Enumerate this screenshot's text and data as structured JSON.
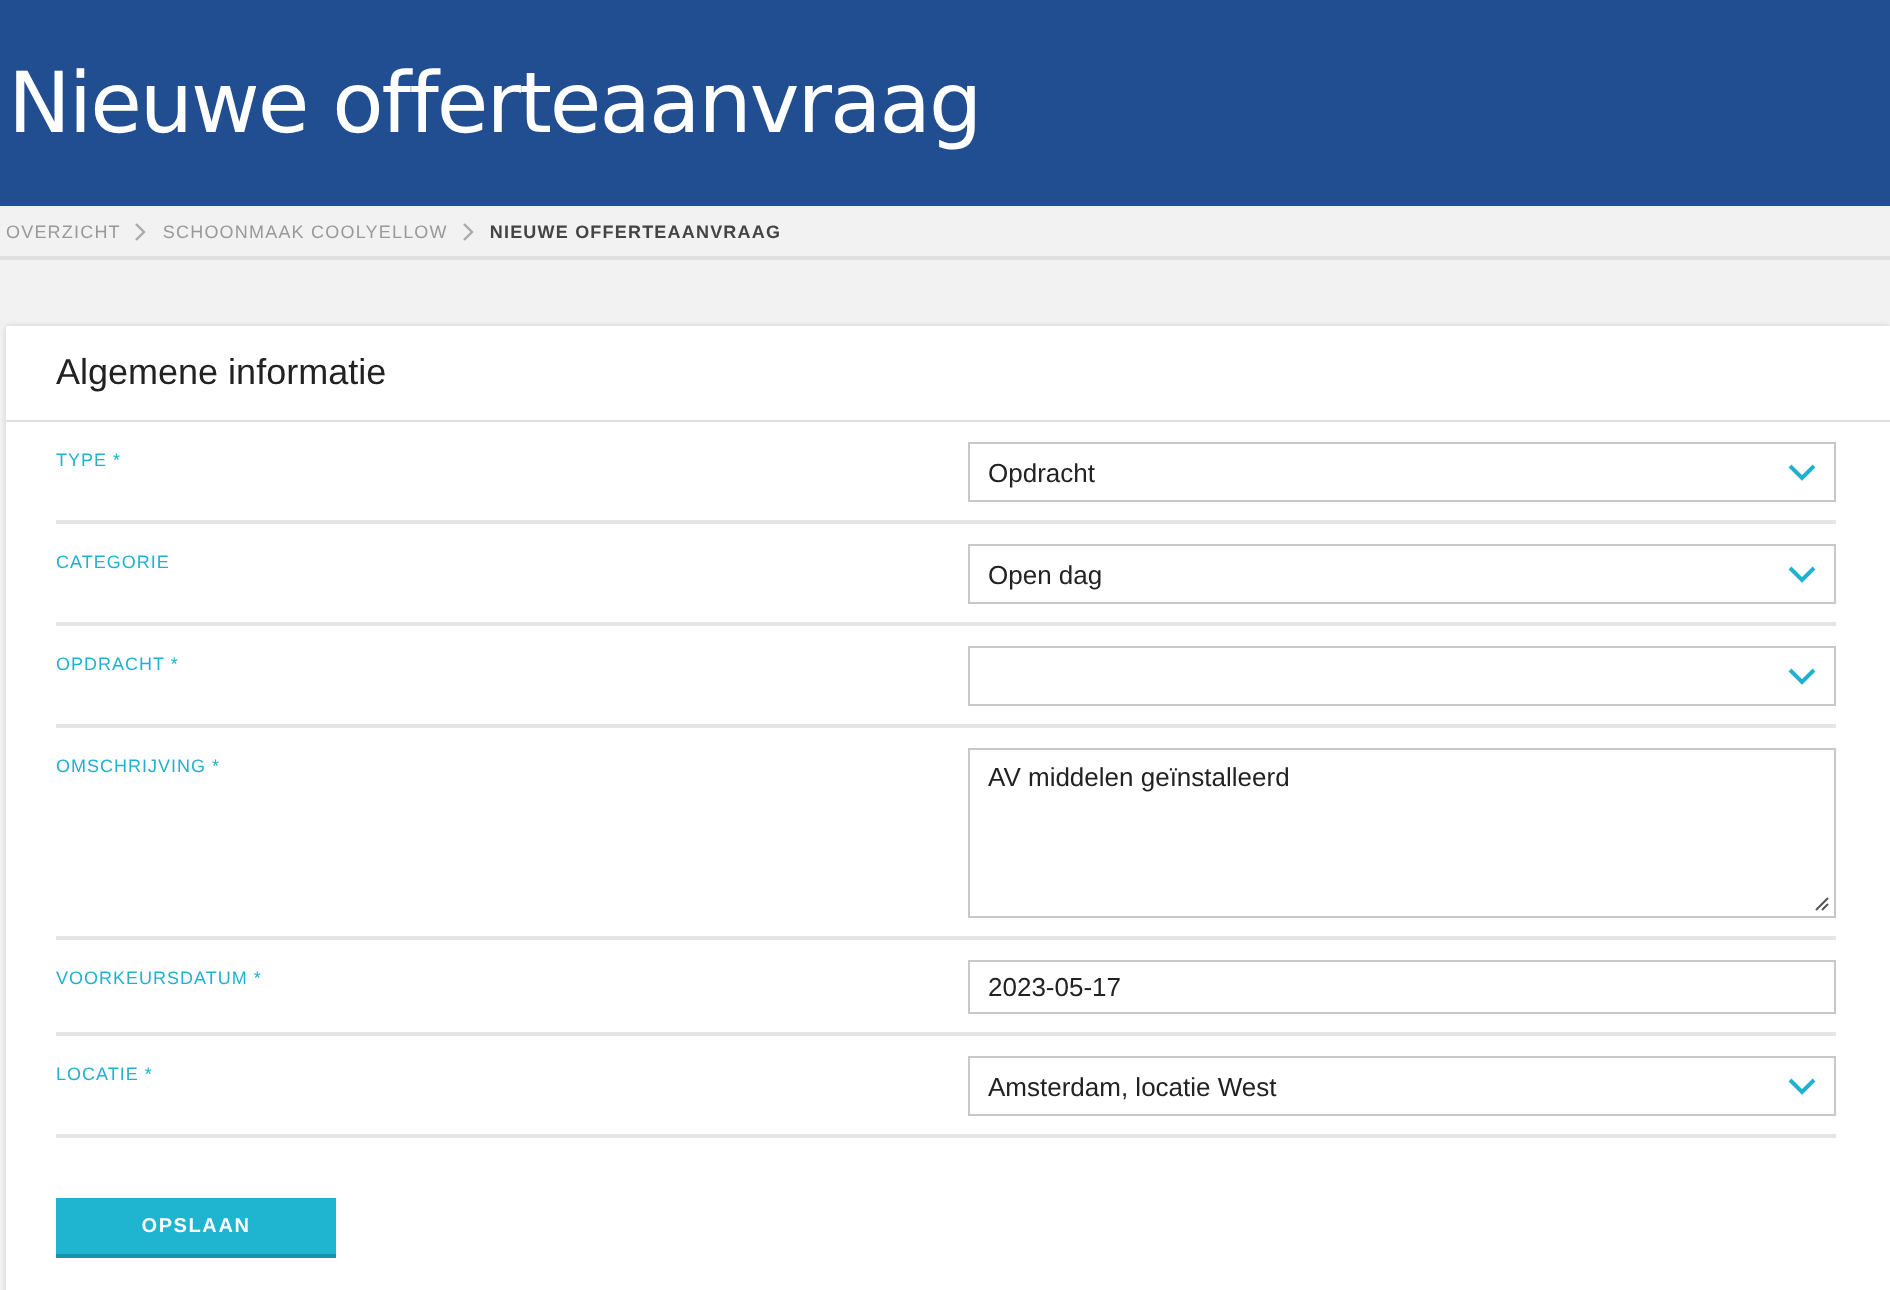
{
  "header": {
    "title": "Nieuwe offerteaanvraag"
  },
  "breadcrumb": [
    {
      "label": "OVERZICHT",
      "current": false
    },
    {
      "label": "SCHOONMAAK COOLYELLOW",
      "current": false
    },
    {
      "label": "NIEUWE OFFERTEAANVRAAG",
      "current": true
    }
  ],
  "card": {
    "title": "Algemene informatie",
    "fields": [
      {
        "label": "TYPE *",
        "kind": "select",
        "value": "Opdracht"
      },
      {
        "label": "CATEGORIE",
        "kind": "select",
        "value": "Open dag"
      },
      {
        "label": "OPDRACHT *",
        "kind": "select"
      },
      {
        "label": "OMSCHRIJVING *",
        "kind": "textarea",
        "value": "AV middelen geïnstalleerd"
      },
      {
        "label": "VOORKEURSDATUM *",
        "kind": "text",
        "value": "2023-05-17"
      },
      {
        "label": "LOCATIE *",
        "kind": "select",
        "value": "Amsterdam, locatie West"
      }
    ],
    "save_button": "OPSLAAN"
  }
}
